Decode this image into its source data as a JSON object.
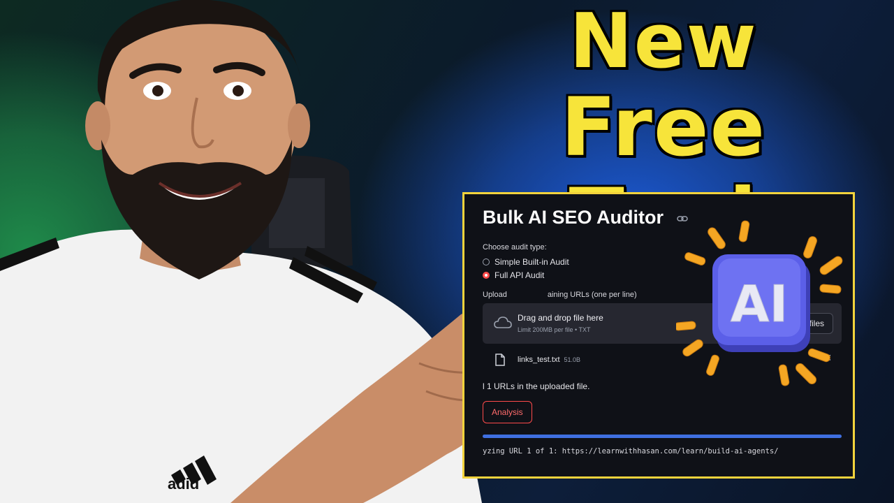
{
  "headline": {
    "line1": "New",
    "line2": "Free Tool"
  },
  "app": {
    "title": "Bulk AI SEO Auditor",
    "audit_type_label": "Choose audit type:",
    "options": [
      {
        "label": "Simple Built-in Audit",
        "selected": false
      },
      {
        "label": "Full API Audit",
        "selected": true
      }
    ],
    "upload_label": "Upload",
    "upload_label_tail": "aining URLs (one per line)",
    "dropzone": {
      "title": "Drag and drop file here",
      "subtitle": "Limit 200MB per file • TXT",
      "browse_label": "e files"
    },
    "file": {
      "name": "links_test.txt",
      "size": "51.0B"
    },
    "found_text": "l 1 URLs in the uploaded file.",
    "run_button": "Analysis",
    "progress": 1.0,
    "status_text": "yzing URL 1 of 1: https://learnwithhasan.com/learn/build-ai-agents/"
  },
  "badge": {
    "text": "AI"
  },
  "shirt_brand": "adid",
  "colors": {
    "headline": "#f7e43a",
    "panel_border": "#f2d33c",
    "accent_red": "#ff4b4b",
    "progress_blue": "#3f6fe0",
    "badge_purple": "#5b5fe8"
  }
}
